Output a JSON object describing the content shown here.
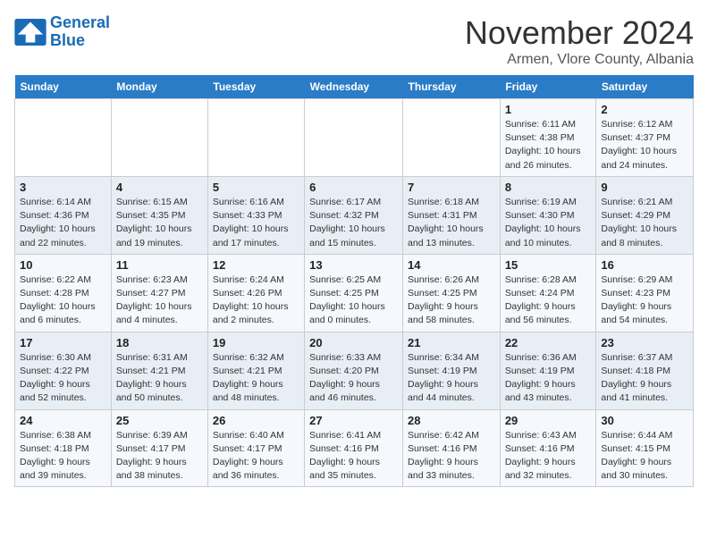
{
  "logo": {
    "line1": "General",
    "line2": "Blue"
  },
  "header": {
    "month": "November 2024",
    "location": "Armen, Vlore County, Albania"
  },
  "weekdays": [
    "Sunday",
    "Monday",
    "Tuesday",
    "Wednesday",
    "Thursday",
    "Friday",
    "Saturday"
  ],
  "weeks": [
    [
      {
        "day": "",
        "detail": ""
      },
      {
        "day": "",
        "detail": ""
      },
      {
        "day": "",
        "detail": ""
      },
      {
        "day": "",
        "detail": ""
      },
      {
        "day": "",
        "detail": ""
      },
      {
        "day": "1",
        "detail": "Sunrise: 6:11 AM\nSunset: 4:38 PM\nDaylight: 10 hours and 26 minutes."
      },
      {
        "day": "2",
        "detail": "Sunrise: 6:12 AM\nSunset: 4:37 PM\nDaylight: 10 hours and 24 minutes."
      }
    ],
    [
      {
        "day": "3",
        "detail": "Sunrise: 6:14 AM\nSunset: 4:36 PM\nDaylight: 10 hours and 22 minutes."
      },
      {
        "day": "4",
        "detail": "Sunrise: 6:15 AM\nSunset: 4:35 PM\nDaylight: 10 hours and 19 minutes."
      },
      {
        "day": "5",
        "detail": "Sunrise: 6:16 AM\nSunset: 4:33 PM\nDaylight: 10 hours and 17 minutes."
      },
      {
        "day": "6",
        "detail": "Sunrise: 6:17 AM\nSunset: 4:32 PM\nDaylight: 10 hours and 15 minutes."
      },
      {
        "day": "7",
        "detail": "Sunrise: 6:18 AM\nSunset: 4:31 PM\nDaylight: 10 hours and 13 minutes."
      },
      {
        "day": "8",
        "detail": "Sunrise: 6:19 AM\nSunset: 4:30 PM\nDaylight: 10 hours and 10 minutes."
      },
      {
        "day": "9",
        "detail": "Sunrise: 6:21 AM\nSunset: 4:29 PM\nDaylight: 10 hours and 8 minutes."
      }
    ],
    [
      {
        "day": "10",
        "detail": "Sunrise: 6:22 AM\nSunset: 4:28 PM\nDaylight: 10 hours and 6 minutes."
      },
      {
        "day": "11",
        "detail": "Sunrise: 6:23 AM\nSunset: 4:27 PM\nDaylight: 10 hours and 4 minutes."
      },
      {
        "day": "12",
        "detail": "Sunrise: 6:24 AM\nSunset: 4:26 PM\nDaylight: 10 hours and 2 minutes."
      },
      {
        "day": "13",
        "detail": "Sunrise: 6:25 AM\nSunset: 4:25 PM\nDaylight: 10 hours and 0 minutes."
      },
      {
        "day": "14",
        "detail": "Sunrise: 6:26 AM\nSunset: 4:25 PM\nDaylight: 9 hours and 58 minutes."
      },
      {
        "day": "15",
        "detail": "Sunrise: 6:28 AM\nSunset: 4:24 PM\nDaylight: 9 hours and 56 minutes."
      },
      {
        "day": "16",
        "detail": "Sunrise: 6:29 AM\nSunset: 4:23 PM\nDaylight: 9 hours and 54 minutes."
      }
    ],
    [
      {
        "day": "17",
        "detail": "Sunrise: 6:30 AM\nSunset: 4:22 PM\nDaylight: 9 hours and 52 minutes."
      },
      {
        "day": "18",
        "detail": "Sunrise: 6:31 AM\nSunset: 4:21 PM\nDaylight: 9 hours and 50 minutes."
      },
      {
        "day": "19",
        "detail": "Sunrise: 6:32 AM\nSunset: 4:21 PM\nDaylight: 9 hours and 48 minutes."
      },
      {
        "day": "20",
        "detail": "Sunrise: 6:33 AM\nSunset: 4:20 PM\nDaylight: 9 hours and 46 minutes."
      },
      {
        "day": "21",
        "detail": "Sunrise: 6:34 AM\nSunset: 4:19 PM\nDaylight: 9 hours and 44 minutes."
      },
      {
        "day": "22",
        "detail": "Sunrise: 6:36 AM\nSunset: 4:19 PM\nDaylight: 9 hours and 43 minutes."
      },
      {
        "day": "23",
        "detail": "Sunrise: 6:37 AM\nSunset: 4:18 PM\nDaylight: 9 hours and 41 minutes."
      }
    ],
    [
      {
        "day": "24",
        "detail": "Sunrise: 6:38 AM\nSunset: 4:18 PM\nDaylight: 9 hours and 39 minutes."
      },
      {
        "day": "25",
        "detail": "Sunrise: 6:39 AM\nSunset: 4:17 PM\nDaylight: 9 hours and 38 minutes."
      },
      {
        "day": "26",
        "detail": "Sunrise: 6:40 AM\nSunset: 4:17 PM\nDaylight: 9 hours and 36 minutes."
      },
      {
        "day": "27",
        "detail": "Sunrise: 6:41 AM\nSunset: 4:16 PM\nDaylight: 9 hours and 35 minutes."
      },
      {
        "day": "28",
        "detail": "Sunrise: 6:42 AM\nSunset: 4:16 PM\nDaylight: 9 hours and 33 minutes."
      },
      {
        "day": "29",
        "detail": "Sunrise: 6:43 AM\nSunset: 4:16 PM\nDaylight: 9 hours and 32 minutes."
      },
      {
        "day": "30",
        "detail": "Sunrise: 6:44 AM\nSunset: 4:15 PM\nDaylight: 9 hours and 30 minutes."
      }
    ]
  ]
}
